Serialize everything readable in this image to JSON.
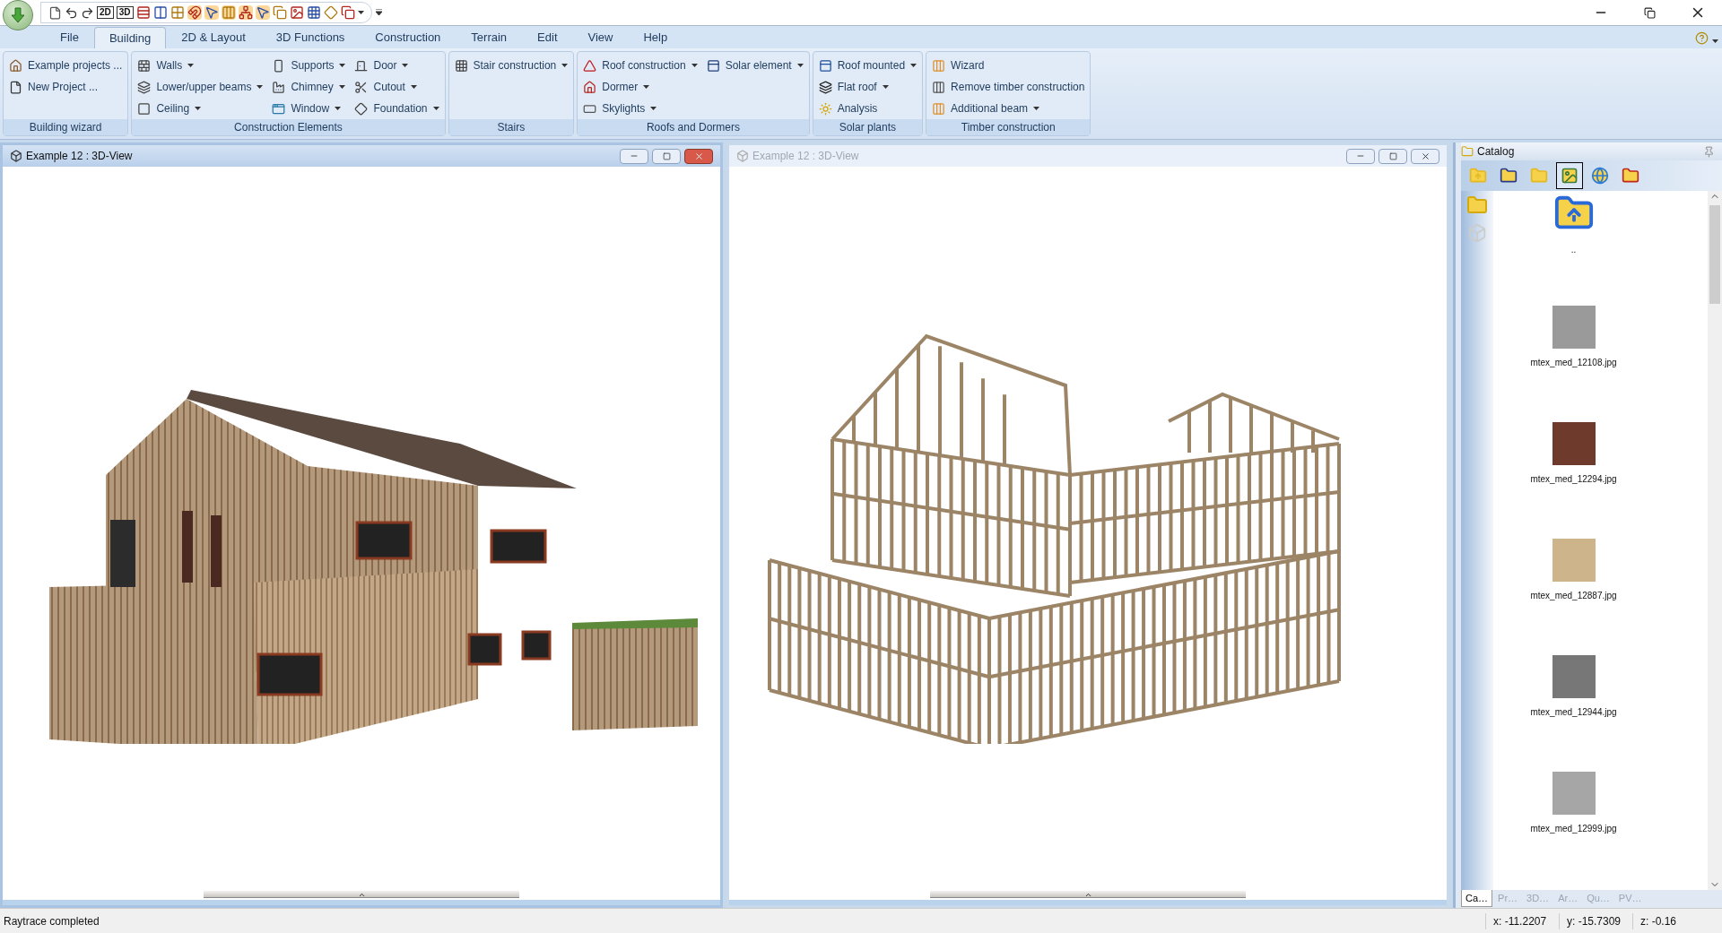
{
  "quick_access": {
    "labels": [
      "2D",
      "3D"
    ]
  },
  "menu_tabs": [
    {
      "label": "File",
      "selected": false
    },
    {
      "label": "Building",
      "selected": true
    },
    {
      "label": "2D & Layout",
      "selected": false
    },
    {
      "label": "3D Functions",
      "selected": false
    },
    {
      "label": "Construction",
      "selected": false
    },
    {
      "label": "Terrain",
      "selected": false
    },
    {
      "label": "Edit",
      "selected": false
    },
    {
      "label": "View",
      "selected": false
    },
    {
      "label": "Help",
      "selected": false
    }
  ],
  "ribbon_groups": [
    {
      "label": "Building wizard",
      "columns": [
        [
          {
            "label": "Example projects ...",
            "dropdown": false
          },
          {
            "label": "New Project ...",
            "dropdown": false
          }
        ]
      ]
    },
    {
      "label": "Construction Elements",
      "columns": [
        [
          {
            "label": "Walls",
            "dropdown": true
          },
          {
            "label": "Lower/upper beams",
            "dropdown": true
          },
          {
            "label": "Ceiling",
            "dropdown": true
          }
        ],
        [
          {
            "label": "Supports",
            "dropdown": true
          },
          {
            "label": "Chimney",
            "dropdown": true
          },
          {
            "label": "Window",
            "dropdown": true
          }
        ],
        [
          {
            "label": "Door",
            "dropdown": true
          },
          {
            "label": "Cutout",
            "dropdown": true
          },
          {
            "label": "Foundation",
            "dropdown": true
          }
        ]
      ]
    },
    {
      "label": "Stairs",
      "columns": [
        [
          {
            "label": "Stair construction",
            "dropdown": true
          }
        ]
      ]
    },
    {
      "label": "Roofs and Dormers",
      "columns": [
        [
          {
            "label": "Roof construction",
            "dropdown": true
          },
          {
            "label": "Dormer",
            "dropdown": true
          },
          {
            "label": "Skylights",
            "dropdown": true
          }
        ],
        [
          {
            "label": "Solar element",
            "dropdown": true
          }
        ]
      ]
    },
    {
      "label": "Solar plants",
      "columns": [
        [
          {
            "label": "Roof mounted",
            "dropdown": true
          },
          {
            "label": "Flat roof",
            "dropdown": true
          },
          {
            "label": "Analysis",
            "dropdown": false
          }
        ]
      ]
    },
    {
      "label": "Timber construction",
      "columns": [
        [
          {
            "label": "Wizard",
            "dropdown": false
          },
          {
            "label": "Remove timber construction",
            "dropdown": false
          },
          {
            "label": "Additional beam",
            "dropdown": true
          }
        ]
      ]
    }
  ],
  "views": [
    {
      "title": "Example 12 : 3D-View",
      "active": true,
      "kind": "house"
    },
    {
      "title": "Example 12 : 3D-View",
      "active": false,
      "kind": "frame"
    }
  ],
  "catalog": {
    "title": "Catalog",
    "toolbar": [
      {
        "selected": false
      },
      {
        "selected": false
      },
      {
        "selected": false
      },
      {
        "selected": true
      },
      {
        "selected": false
      },
      {
        "selected": false
      }
    ],
    "parent_item": {
      "label": ".."
    },
    "items": [
      {
        "label": "mtex_med_12108.jpg",
        "color": "#9a9a9a"
      },
      {
        "label": "mtex_med_12294.jpg",
        "color": "#6e3a2c"
      },
      {
        "label": "mtex_med_12887.jpg",
        "color": "#cdb48a"
      },
      {
        "label": "mtex_med_12944.jpg",
        "color": "#777777"
      },
      {
        "label": "mtex_med_12999.jpg",
        "color": "#a6a6a6"
      }
    ],
    "tabs": [
      {
        "label": "Ca…",
        "selected": true
      },
      {
        "label": "Pr…",
        "selected": false
      },
      {
        "label": "3D…",
        "selected": false
      },
      {
        "label": "Ar…",
        "selected": false
      },
      {
        "label": "Qu…",
        "selected": false
      },
      {
        "label": "PV…",
        "selected": false
      }
    ]
  },
  "status_bar": {
    "message": "Raytrace completed",
    "x": "x: -11.2207",
    "y": "y: -15.7309",
    "z": "z: -0.16"
  }
}
